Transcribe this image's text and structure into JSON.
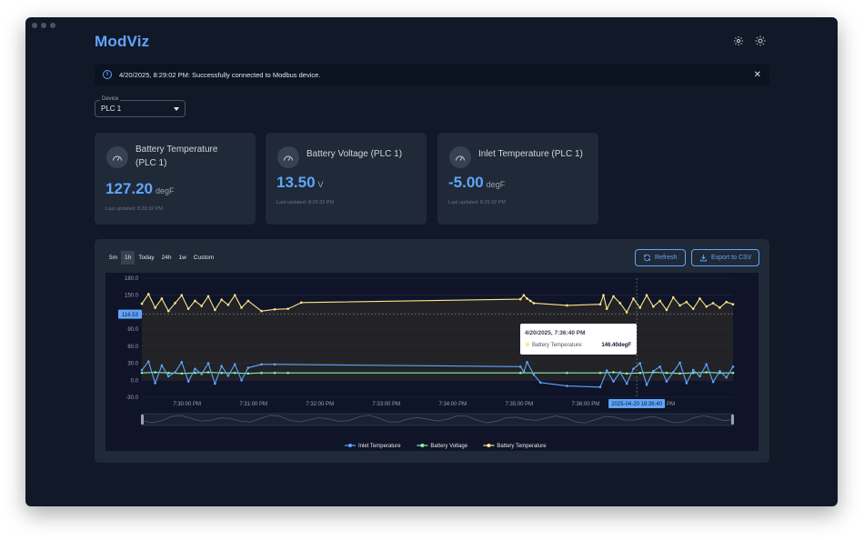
{
  "app": {
    "title": "ModViz"
  },
  "header": {
    "settings_icon": "gear-icon",
    "theme_icon": "sun-icon"
  },
  "alert": {
    "message": "4/20/2025, 8:29:02 PM: Successfully connected to Modbus device.",
    "close": "✕"
  },
  "device": {
    "label": "Device",
    "value": "PLC 1"
  },
  "cards": [
    {
      "title_line1": "Battery Temperature",
      "title_line2": "(PLC 1)",
      "value": "127.20",
      "unit": "degF",
      "updated": "Last updated: 8:29:32 PM"
    },
    {
      "title_line1": "Battery Voltage (PLC 1)",
      "title_line2": "",
      "value": "13.50",
      "unit": "V",
      "updated": "Last updated: 8:29:32 PM"
    },
    {
      "title_line1": "Inlet Temperature (PLC 1)",
      "title_line2": "",
      "value": "-5.00",
      "unit": "degF",
      "updated": "Last updated: 8:29:32 PM"
    }
  ],
  "ranges": [
    "5m",
    "1h",
    "Today",
    "24h",
    "1w",
    "Custom"
  ],
  "active_range": "1h",
  "buttons": {
    "refresh": "Refresh",
    "export": "Export to CSV"
  },
  "colors": {
    "accent": "#60a5fa",
    "inlet": "#60a5fa",
    "voltage": "#86efac",
    "battery": "#fde68a"
  },
  "chart_data": {
    "type": "line",
    "ylim": [
      -30,
      180
    ],
    "yticks": [
      "180.0",
      "150.0",
      "120.0",
      "90.0",
      "60.0",
      "30.0",
      "0.0",
      "-30.0"
    ],
    "xticks": [
      "7:30:00 PM",
      "7:31:00 PM",
      "7:32:00 PM",
      "7:33:00 PM",
      "7:34:00 PM",
      "7:35:00 PM",
      "7:36:00 PM"
    ],
    "cursor_y_label": "116.53",
    "cursor_x_label": "2025-04-20 19:36:40",
    "cursor_x_suffix": "PM",
    "tooltip": {
      "title": "4/20/2025, 7:36:40 PM",
      "series": "Battery Temperature:",
      "value": "146.40degF"
    },
    "legend": [
      "Inlet Temperature",
      "Battery Voltage",
      "Battery Temperature"
    ],
    "series": [
      {
        "name": "Battery Temperature",
        "x": [
          0,
          0.1,
          0.2,
          0.3,
          0.4,
          0.5,
          0.6,
          0.7,
          0.8,
          0.9,
          1.0,
          1.1,
          1.2,
          1.3,
          1.4,
          1.5,
          1.6,
          1.8,
          2.0,
          2.2,
          2.4,
          5.7,
          5.75,
          5.8,
          5.85,
          5.9,
          6.4,
          6.9,
          6.95,
          7.0,
          7.1,
          7.2,
          7.3,
          7.4,
          7.5,
          7.6,
          7.7,
          7.8,
          7.9,
          8.0,
          8.1,
          8.2,
          8.3,
          8.4,
          8.5,
          8.6,
          8.7,
          8.8,
          8.9
        ],
        "y": [
          135,
          152,
          128,
          144,
          122,
          136,
          150,
          126,
          140,
          131,
          148,
          124,
          142,
          133,
          150,
          128,
          140,
          122,
          125,
          126,
          137,
          143,
          150,
          144,
          140,
          136,
          132,
          134,
          150,
          126,
          148,
          136,
          120,
          144,
          128,
          150,
          130,
          140,
          124,
          146,
          132,
          138,
          126,
          144,
          130,
          136,
          128,
          138,
          134
        ]
      },
      {
        "name": "Battery Voltage",
        "x": [
          0,
          0.2,
          0.4,
          0.6,
          0.8,
          1.0,
          1.2,
          1.4,
          1.6,
          1.8,
          2.0,
          2.2,
          5.7,
          6.4,
          6.9,
          7.1,
          7.3,
          7.5,
          7.7,
          7.9,
          8.1,
          8.3,
          8.5,
          8.7,
          8.9
        ],
        "y": [
          13,
          14,
          13,
          12,
          13,
          14,
          13,
          13,
          12,
          13,
          13,
          13,
          13,
          13,
          13,
          14,
          12,
          13,
          14,
          13,
          12,
          13,
          14,
          13,
          13
        ]
      },
      {
        "name": "Inlet Temperature",
        "x": [
          0,
          0.1,
          0.2,
          0.3,
          0.4,
          0.5,
          0.6,
          0.7,
          0.8,
          0.9,
          1.0,
          1.1,
          1.2,
          1.3,
          1.4,
          1.5,
          1.6,
          1.8,
          2.0,
          5.7,
          5.75,
          5.8,
          5.9,
          6.0,
          6.4,
          6.9,
          7.0,
          7.1,
          7.2,
          7.3,
          7.4,
          7.5,
          7.6,
          7.7,
          7.8,
          7.9,
          8.0,
          8.1,
          8.2,
          8.3,
          8.4,
          8.5,
          8.6,
          8.7,
          8.8,
          8.9
        ],
        "y": [
          18,
          33,
          -5,
          26,
          7,
          14,
          32,
          -2,
          20,
          11,
          30,
          -6,
          25,
          8,
          28,
          0,
          22,
          28,
          28,
          24,
          15,
          32,
          10,
          -4,
          -10,
          -12,
          17,
          -2,
          14,
          -6,
          20,
          30,
          -8,
          16,
          24,
          -2,
          14,
          31,
          -5,
          18,
          7,
          28,
          -3,
          16,
          5,
          24
        ]
      }
    ]
  }
}
